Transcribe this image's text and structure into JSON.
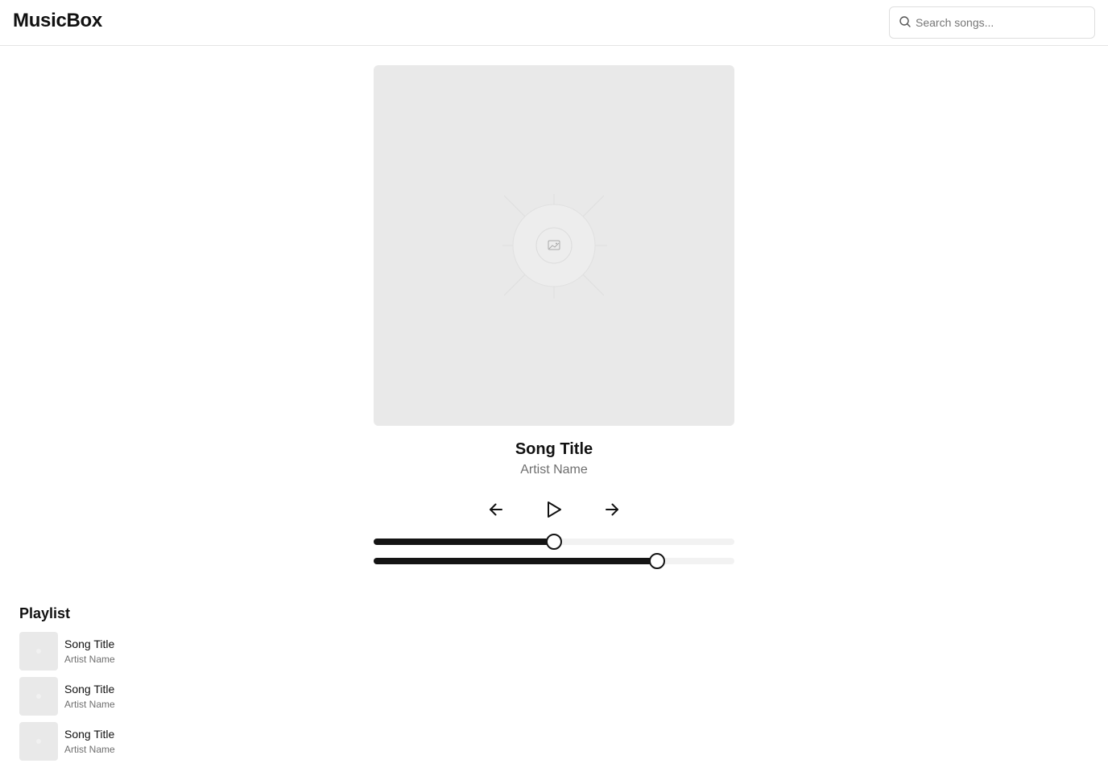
{
  "app": {
    "title": "MusicBox"
  },
  "search": {
    "placeholder": "Search songs...",
    "value": "",
    "icon": "search-icon"
  },
  "now_playing": {
    "title": "Song Title",
    "artist": "Artist Name",
    "artwork_icon": "image-placeholder-icon",
    "progress_fraction": 0.5,
    "volume_fraction": 0.786
  },
  "controls": {
    "previous_icon": "arrow-left-icon",
    "play_icon": "play-icon",
    "next_icon": "arrow-right-icon"
  },
  "playlist": {
    "heading": "Playlist",
    "items": [
      {
        "title": "Song Title",
        "artist": "Artist Name"
      },
      {
        "title": "Song Title",
        "artist": "Artist Name"
      },
      {
        "title": "Song Title",
        "artist": "Artist Name"
      }
    ]
  },
  "colors": {
    "accent": "#141414",
    "placeholder_bg": "#e9e9e9",
    "track_bg": "#f2f2f2",
    "muted_text": "#6f6f6f",
    "border": "#e5e5e5"
  }
}
